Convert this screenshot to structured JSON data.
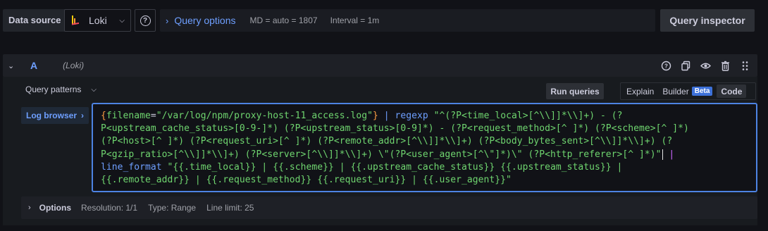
{
  "topbar": {
    "data_source_label": "Data source",
    "datasource_name": "Loki",
    "query_options_title": "Query options",
    "md_text": "MD = auto = 1807",
    "interval_text": "Interval = 1m",
    "inspector_label": "Query inspector"
  },
  "query": {
    "ref_id": "A",
    "datasource_hint": "(Loki)",
    "patterns_label": "Query patterns",
    "run_label": "Run queries",
    "modes": [
      "Explain",
      "Builder",
      "Code"
    ],
    "beta_badge": "Beta",
    "log_browser_label": "Log browser",
    "code": {
      "l1a": "{",
      "l1b": "filename",
      "l1c": "=",
      "l1d": "\"/var/log/npm/proxy-host-11_access.log\"",
      "l1e": "}",
      "l1f": " | ",
      "l1g": "regexp",
      "l1h": " \"^(?P<time_local>[^\\\\]]*\\\\]+) - (?",
      "l2": "P<upstream_cache_status>[0-9-]*) (?P<upstream_status>[0-9]*) - (?P<request_method>[^ ]*) (?P<scheme>[^ ]*)",
      "l3": "(?P<host>[^ ]*) (?P<request_uri>[^ ]*) (?P<remote_addr>[^\\\\]]*\\\\]+) (?P<body_bytes_sent>[^\\\\]]*\\\\]+) (?",
      "l4a": "P<gzip_ratio>[^\\\\]]*\\\\]+) (?P<server>[^\\\\]]*\\\\]+) \\\"(?P<user_agent>[^\\\"]*)\\\" (?P<http_referer>[^ ]*)\"",
      "l4b": " |",
      "l5a": "line_format",
      "l5b": " \"{{.time_local}} | {{.scheme}} | {{.upstream_cache_status}} {{.upstream_status}} |",
      "l6": "{{.remote_addr}} | {{.request_method}} {{.request_uri}} | {{.user_agent}}\""
    },
    "options": {
      "title": "Options",
      "resolution": "Resolution: 1/1",
      "type": "Type: Range",
      "line_limit": "Line limit: 25"
    }
  },
  "colors": {
    "accent": "#6e9fff",
    "editor_border": "#4d83e3",
    "string_green": "#6fd56f",
    "brace_orange": "#ff9f43"
  }
}
